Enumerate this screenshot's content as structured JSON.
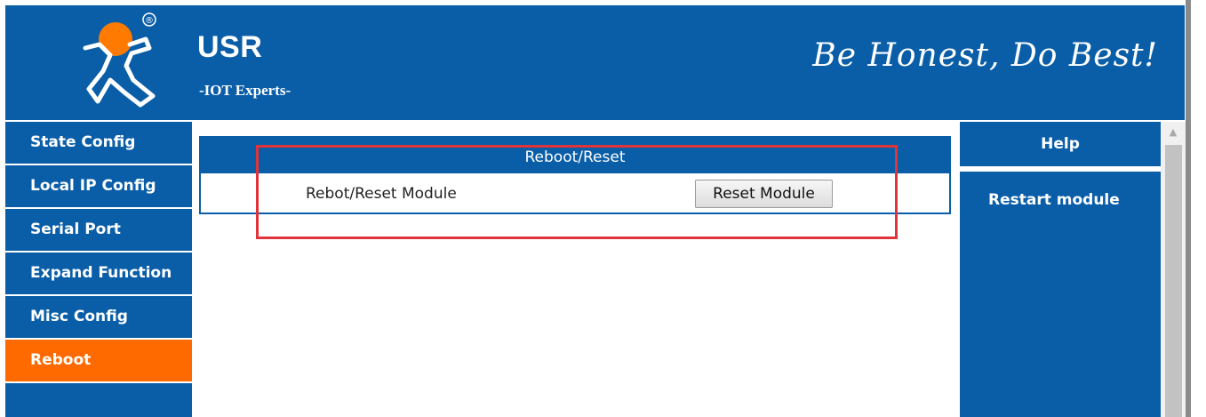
{
  "header": {
    "brand_name": "USR",
    "brand_tagline": "-IOT Experts-",
    "slogan": "Be Honest, Do Best!",
    "registered_mark": "®"
  },
  "sidebar": {
    "items": [
      {
        "label": "State Config",
        "active": false
      },
      {
        "label": "Local IP Config",
        "active": false
      },
      {
        "label": "Serial Port",
        "active": false
      },
      {
        "label": "Expand Function",
        "active": false
      },
      {
        "label": "Misc Config",
        "active": false
      },
      {
        "label": "Reboot",
        "active": true
      }
    ]
  },
  "panel": {
    "title": "Reboot/Reset",
    "row_label": "Rebot/Reset Module",
    "button_label": "Reset Module"
  },
  "help": {
    "title": "Help",
    "body": "Restart module"
  },
  "colors": {
    "brand_blue": "#0a5ea8",
    "active_orange": "#ff6a00",
    "highlight_red": "#e0333a"
  },
  "icons": {
    "logo": "usr-running-figure-icon",
    "scroll_up": "scroll-up-arrow-icon"
  }
}
